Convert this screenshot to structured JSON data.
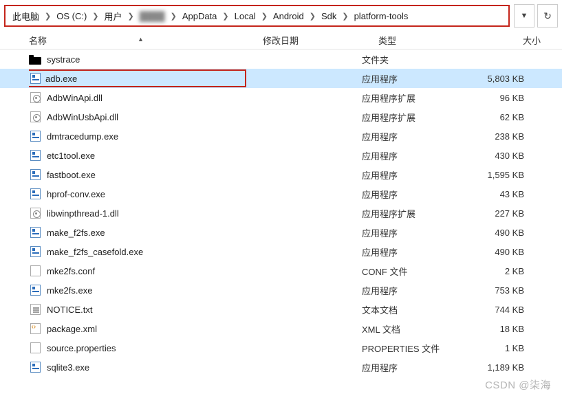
{
  "breadcrumb": {
    "items": [
      "此电脑",
      "OS (C:)",
      "用户",
      "",
      "AppData",
      "Local",
      "Android",
      "Sdk",
      "platform-tools"
    ]
  },
  "columns": {
    "name": "名称",
    "date": "修改日期",
    "type": "类型",
    "size": "大小"
  },
  "files": [
    {
      "icon": "folder",
      "name": "systrace",
      "type": "文件夹",
      "size": ""
    },
    {
      "icon": "exe",
      "name": "adb.exe",
      "type": "应用程序",
      "size": "5,803 KB",
      "highlight": true,
      "selected": true
    },
    {
      "icon": "dll",
      "name": "AdbWinApi.dll",
      "type": "应用程序扩展",
      "size": "96 KB"
    },
    {
      "icon": "dll",
      "name": "AdbWinUsbApi.dll",
      "type": "应用程序扩展",
      "size": "62 KB"
    },
    {
      "icon": "exe",
      "name": "dmtracedump.exe",
      "type": "应用程序",
      "size": "238 KB"
    },
    {
      "icon": "exe",
      "name": "etc1tool.exe",
      "type": "应用程序",
      "size": "430 KB"
    },
    {
      "icon": "exe",
      "name": "fastboot.exe",
      "type": "应用程序",
      "size": "1,595 KB"
    },
    {
      "icon": "exe",
      "name": "hprof-conv.exe",
      "type": "应用程序",
      "size": "43 KB"
    },
    {
      "icon": "dll",
      "name": "libwinpthread-1.dll",
      "type": "应用程序扩展",
      "size": "227 KB"
    },
    {
      "icon": "exe",
      "name": "make_f2fs.exe",
      "type": "应用程序",
      "size": "490 KB"
    },
    {
      "icon": "exe",
      "name": "make_f2fs_casefold.exe",
      "type": "应用程序",
      "size": "490 KB"
    },
    {
      "icon": "generic",
      "name": "mke2fs.conf",
      "type": "CONF 文件",
      "size": "2 KB"
    },
    {
      "icon": "exe",
      "name": "mke2fs.exe",
      "type": "应用程序",
      "size": "753 KB"
    },
    {
      "icon": "txt",
      "name": "NOTICE.txt",
      "type": "文本文档",
      "size": "744 KB"
    },
    {
      "icon": "xml",
      "name": "package.xml",
      "type": "XML 文档",
      "size": "18 KB"
    },
    {
      "icon": "generic",
      "name": "source.properties",
      "type": "PROPERTIES 文件",
      "size": "1 KB"
    },
    {
      "icon": "exe",
      "name": "sqlite3.exe",
      "type": "应用程序",
      "size": "1,189 KB"
    }
  ],
  "watermark": "CSDN @柒海"
}
